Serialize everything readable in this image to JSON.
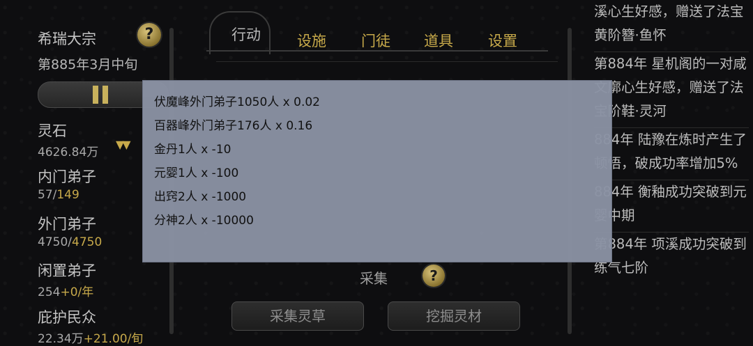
{
  "left": {
    "sect_name": "希瑞大宗",
    "date": "第885年3月中旬",
    "help_glyph": "?",
    "stats": [
      {
        "label": "灵石",
        "value": "4626.84万",
        "value_extra": ""
      },
      {
        "label": "内门弟子",
        "value": "57/",
        "value_extra": "149"
      },
      {
        "label": "外门弟子",
        "value": "4750/",
        "value_extra": "4750"
      },
      {
        "label": "闲置弟子",
        "value": "254",
        "value_extra": "+0/年"
      },
      {
        "label": "庇护民众",
        "value": "22.34万",
        "value_extra": "+21.00/旬"
      }
    ],
    "trend_glyph": "▼▼"
  },
  "tabs": [
    {
      "label": "行动"
    },
    {
      "label": "设施"
    },
    {
      "label": "门徒"
    },
    {
      "label": "道具"
    },
    {
      "label": "设置"
    }
  ],
  "center": {
    "section_label": "采集",
    "help_glyph": "?",
    "buttons": [
      "采集灵草",
      "挖掘灵材"
    ]
  },
  "log": [
    {
      "text": "溪心生好感，赠送了法宝黄阶簪·鱼怀"
    },
    {
      "text": "第884年 星机阁的一对咸文廓心生好感，赠送了法宝阶鞋·灵河"
    },
    {
      "text": "884年 陆豫在炼时产生了顿悟，破成功率增加5%"
    },
    {
      "text": "884年 衡釉成功突破到元婴中期"
    },
    {
      "text": "第884年 项溪成功突破到练气七阶"
    }
  ],
  "popup": {
    "rows": [
      "伏魔峰外门弟子1050人 x 0.02",
      "百器峰外门弟子176人 x 0.16",
      "金丹1人 x -10",
      "元婴1人 x -100",
      "出窍2人 x -1000",
      "分神2人 x -10000"
    ]
  },
  "icons": [
    "help-icon",
    "pause-icon",
    "down-arrows-icon"
  ]
}
